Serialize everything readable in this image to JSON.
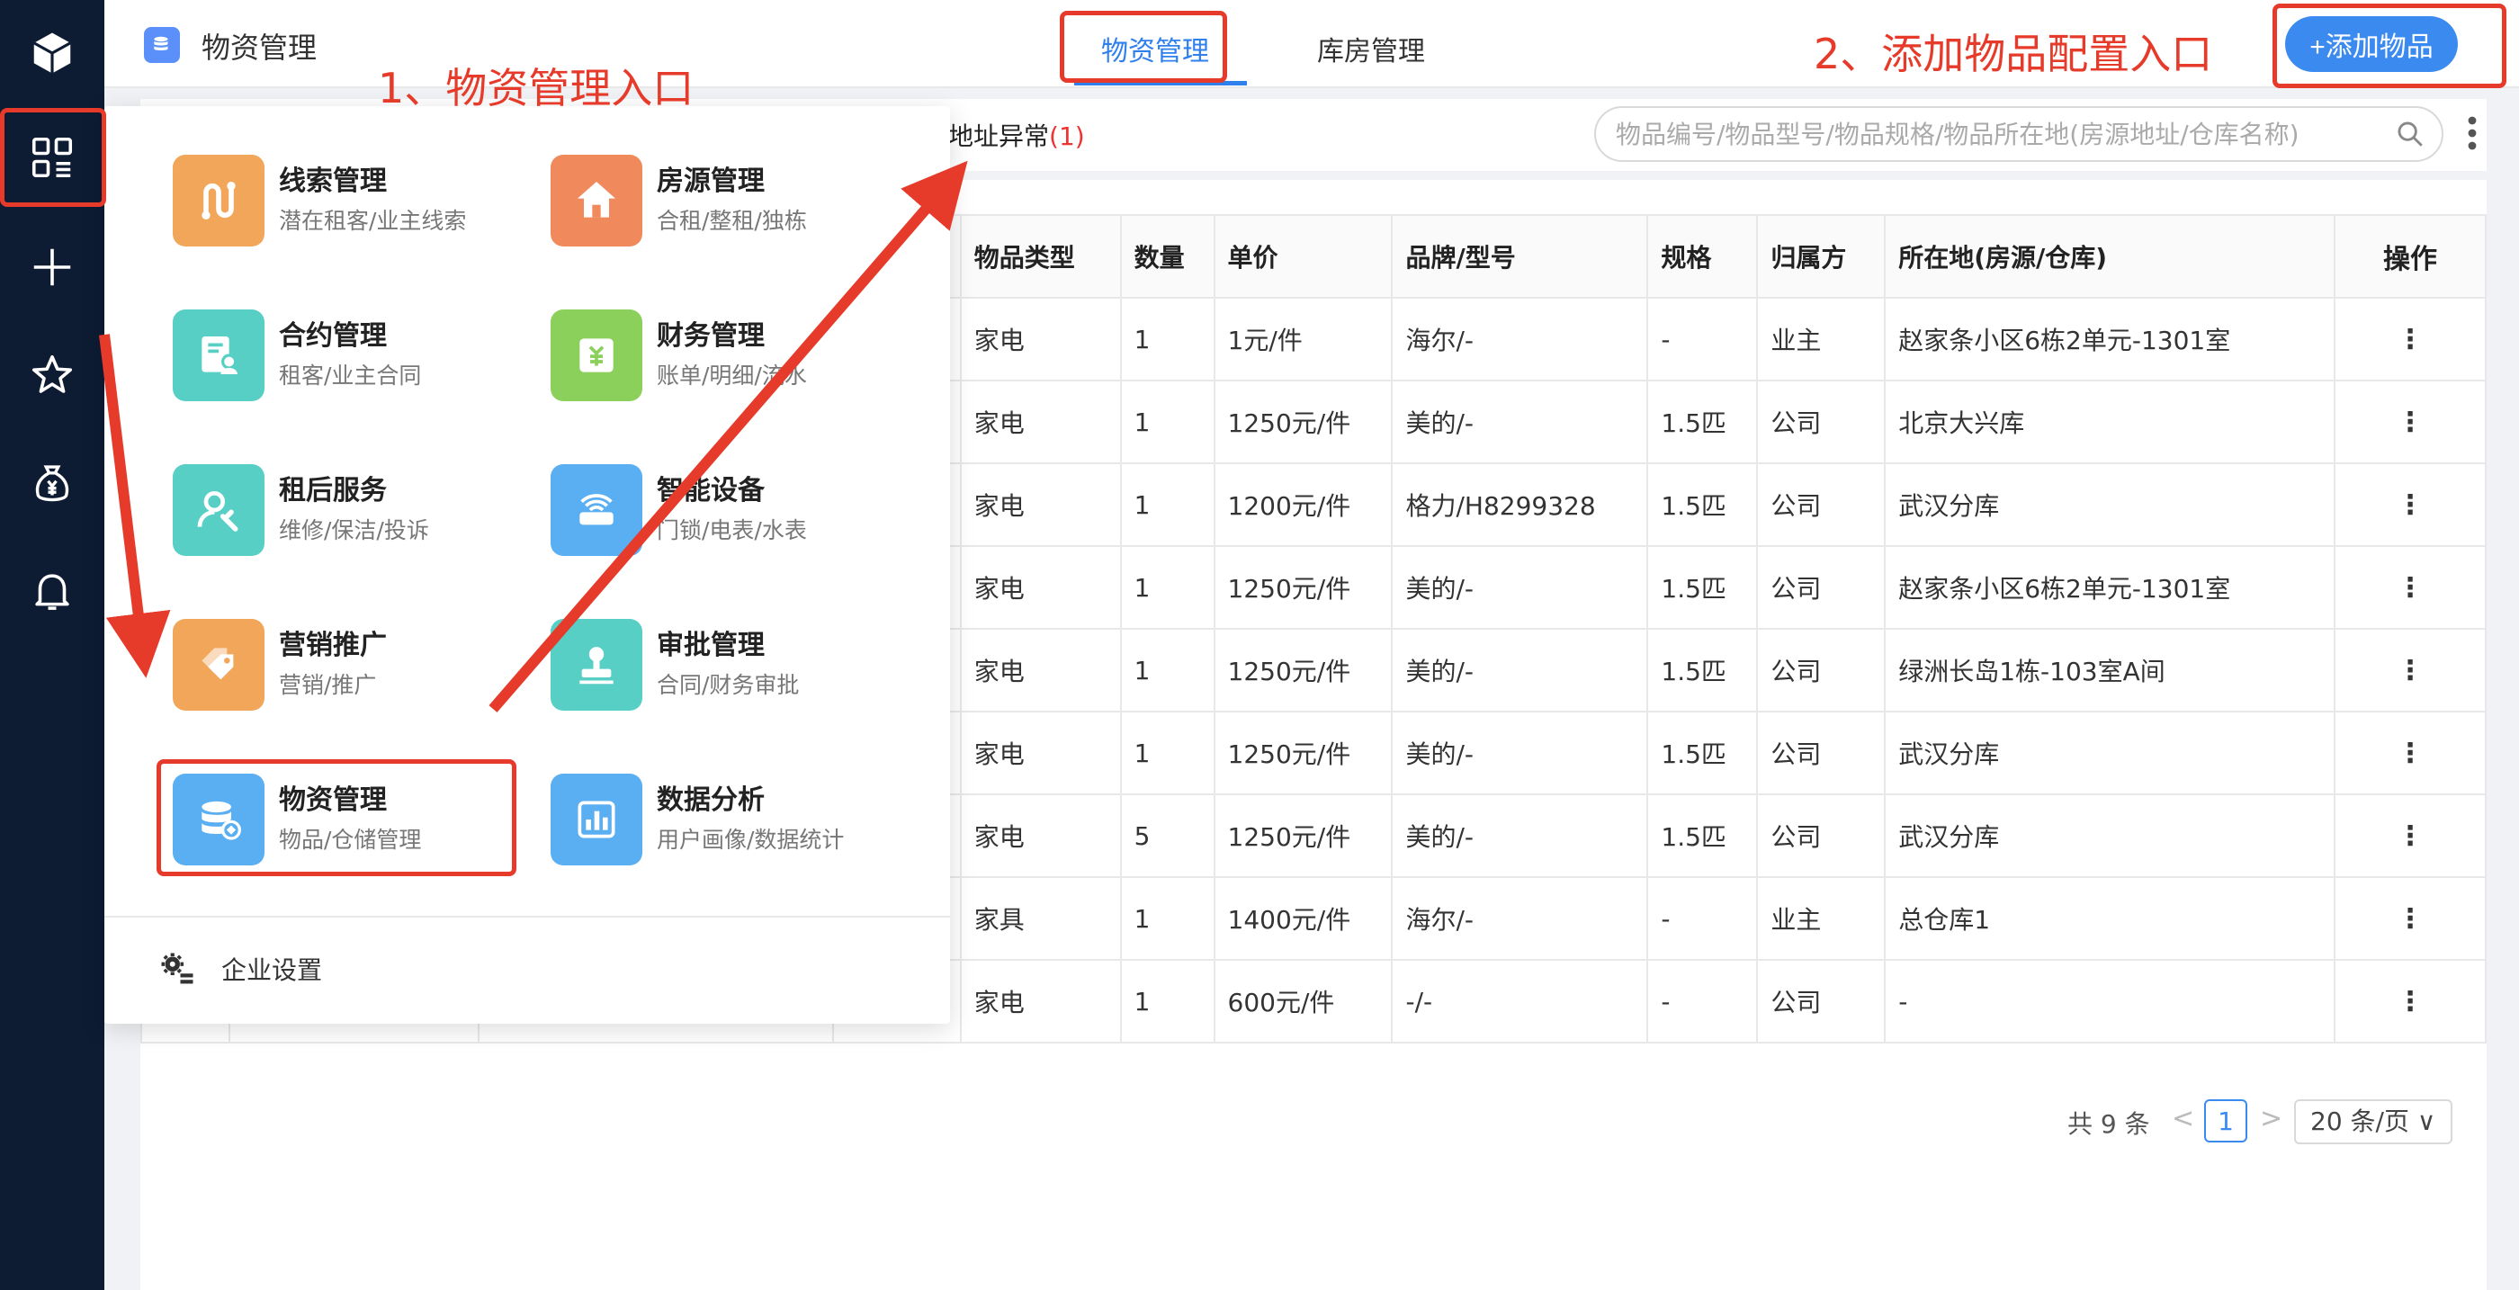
{
  "sidebar": {
    "icons": [
      "cube-icon",
      "apps-grid-icon",
      "plus-icon",
      "star-icon",
      "money-bag-icon",
      "bell-icon"
    ]
  },
  "header": {
    "app_title": "物资管理",
    "tabs": [
      {
        "label": "物资管理",
        "active": true
      },
      {
        "label": "库房管理",
        "active": false
      }
    ],
    "add_button": "+添加物品"
  },
  "filter": {
    "anomaly_label": "地址异常",
    "anomaly_count": "(1)",
    "search_placeholder": "物品编号/物品型号/物品规格/物品所在地(房源地址/仓库名称)"
  },
  "table": {
    "columns": [
      "物品类型",
      "数量",
      "单价",
      "品牌/型号",
      "规格",
      "归属方",
      "所在地(房源/仓库)",
      "操作"
    ],
    "rows": [
      [
        "家电",
        "1",
        "1元/件",
        "海尔/-",
        "-",
        "业主",
        "赵家条小区6栋2单元-1301室",
        "⋮"
      ],
      [
        "家电",
        "1",
        "1250元/件",
        "美的/-",
        "1.5匹",
        "公司",
        "北京大兴库",
        "⋮"
      ],
      [
        "家电",
        "1",
        "1200元/件",
        "格力/H8299328",
        "1.5匹",
        "公司",
        "武汉分库",
        "⋮"
      ],
      [
        "家电",
        "1",
        "1250元/件",
        "美的/-",
        "1.5匹",
        "公司",
        "赵家条小区6栋2单元-1301室",
        "⋮"
      ],
      [
        "家电",
        "1",
        "1250元/件",
        "美的/-",
        "1.5匹",
        "公司",
        "绿洲长岛1栋-103室A间",
        "⋮"
      ],
      [
        "家电",
        "1",
        "1250元/件",
        "美的/-",
        "1.5匹",
        "公司",
        "武汉分库",
        "⋮"
      ],
      [
        "家电",
        "5",
        "1250元/件",
        "美的/-",
        "1.5匹",
        "公司",
        "武汉分库",
        "⋮"
      ],
      [
        "家具",
        "1",
        "1400元/件",
        "海尔/-",
        "-",
        "业主",
        "总仓库1",
        "⋮"
      ],
      [
        "家电",
        "1",
        "600元/件",
        "-/-",
        "-",
        "公司",
        "-",
        "⋮"
      ]
    ]
  },
  "pagination": {
    "total": "共 9 条",
    "prev": "<",
    "page": "1",
    "next": ">",
    "page_size": "20 条/页 ∨"
  },
  "menu": {
    "items": [
      {
        "name": "线索管理",
        "desc": "潜在租客/业主线索",
        "icon": "route-icon",
        "color": "#f2a65a"
      },
      {
        "name": "房源管理",
        "desc": "合租/整租/独栋",
        "icon": "house-icon",
        "color": "#f08a5d"
      },
      {
        "name": "合约管理",
        "desc": "租客/业主合同",
        "icon": "contract-icon",
        "color": "#58cfc5"
      },
      {
        "name": "财务管理",
        "desc": "账单/明细/流水",
        "icon": "finance-icon",
        "color": "#8cd05c"
      },
      {
        "name": "租后服务",
        "desc": "维修/保洁/投诉",
        "icon": "service-icon",
        "color": "#58cfc5"
      },
      {
        "name": "智能设备",
        "desc": "门锁/电表/水表",
        "icon": "router-icon",
        "color": "#5aaef2"
      },
      {
        "name": "营销推广",
        "desc": "营销/推广",
        "icon": "tag-icon",
        "color": "#f2a65a"
      },
      {
        "name": "审批管理",
        "desc": "合同/财务审批",
        "icon": "stamp-icon",
        "color": "#58cfc5"
      },
      {
        "name": "物资管理",
        "desc": "物品/仓储管理",
        "icon": "database-icon",
        "color": "#5aaef2"
      },
      {
        "name": "数据分析",
        "desc": "用户画像/数据统计",
        "icon": "chart-icon",
        "color": "#5aaef2"
      }
    ],
    "settings_label": "企业设置"
  },
  "annotations": {
    "step1": "1、物资管理入口",
    "step2": "2、添加物品配置入口",
    "color": "#e63a2a"
  }
}
